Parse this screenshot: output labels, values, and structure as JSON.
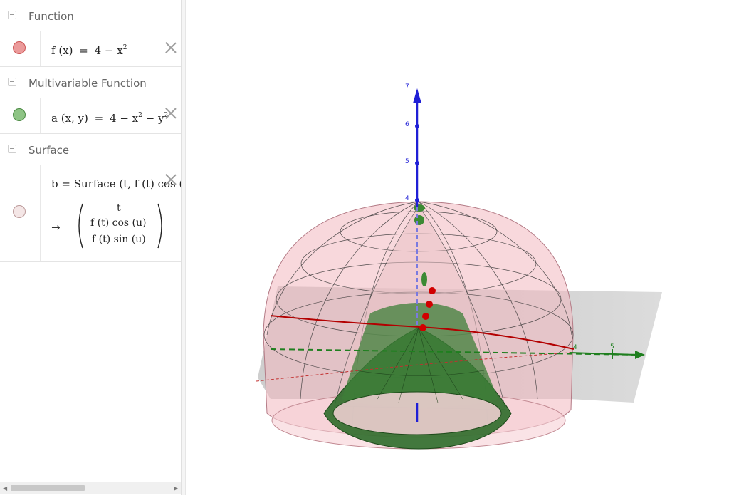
{
  "algebra": {
    "sections": [
      {
        "title": "Function"
      },
      {
        "title": "Multivariable Function"
      },
      {
        "title": "Surface"
      }
    ],
    "function_item": {
      "lhs": "f (x)",
      "eq": "=",
      "rhs": "4 − x",
      "exp": "2",
      "color": "#e06666"
    },
    "multivar_item": {
      "lhs": "a (x, y)",
      "eq": "=",
      "rhs1": "4 − x",
      "exp1": "2",
      "rhs2": " − y",
      "exp2": "2",
      "color": "#7cb36b"
    },
    "surface_item": {
      "definition": "b = Surface (t, f (t)  cos (u",
      "arrow": "→",
      "row1": "t",
      "row2": "f (t)  cos (u)",
      "row3": "f (t)  sin (u)",
      "color": "#f4dede"
    }
  },
  "graphics": {
    "z_axis_ticks": [
      "7",
      "6",
      "5",
      "4"
    ],
    "x_axis_ticks": [
      "4",
      "5"
    ],
    "colors": {
      "z_axis": "#1f1fd6",
      "x_axis": "#1f7f1f",
      "curve": "#c00000",
      "dome": "#f2b8c0",
      "paraboloid": "#2e6b2a"
    }
  }
}
